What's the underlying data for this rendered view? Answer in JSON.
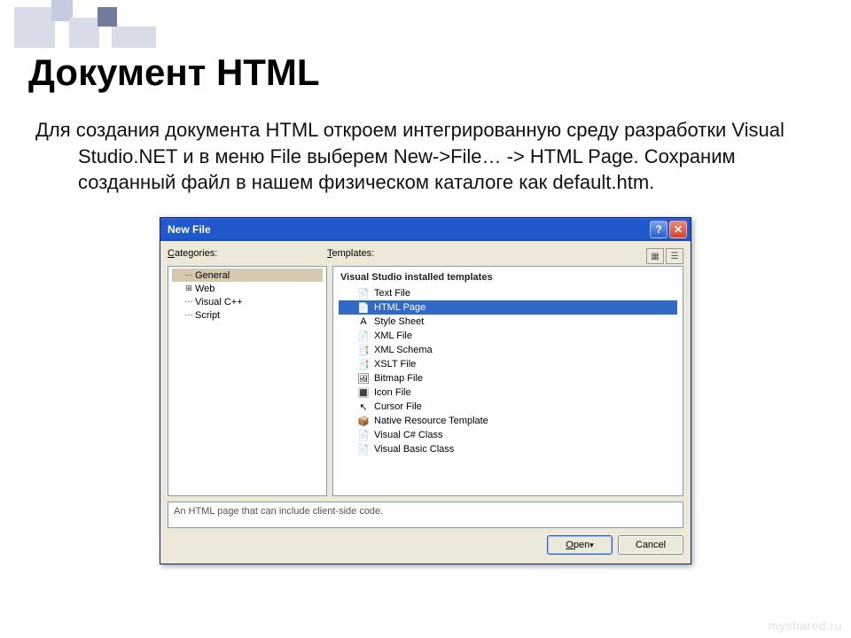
{
  "slide": {
    "title": "Документ HTML",
    "body": "Для создания документа HTML откроем интегрированную среду разработки Visual Studio.NET и в меню File выберем New->File… -> HTML Page. Сохраним созданный файл в нашем физическом каталоге как default.htm.",
    "watermark": "myshared.ru"
  },
  "dialog": {
    "title": "New File",
    "categories_label": "Categories:",
    "templates_label": "Templates:",
    "categories": [
      {
        "label": "General",
        "selected": true,
        "expandable": false
      },
      {
        "label": "Web",
        "selected": false,
        "expandable": true
      },
      {
        "label": "Visual C++",
        "selected": false,
        "expandable": false
      },
      {
        "label": "Script",
        "selected": false,
        "expandable": false
      }
    ],
    "templates_group": "Visual Studio installed templates",
    "templates": [
      {
        "label": "Text File",
        "icon": "📄",
        "selected": false
      },
      {
        "label": "HTML Page",
        "icon": "📄",
        "selected": true
      },
      {
        "label": "Style Sheet",
        "icon": "A",
        "selected": false
      },
      {
        "label": "XML File",
        "icon": "📄",
        "selected": false
      },
      {
        "label": "XML Schema",
        "icon": "📑",
        "selected": false
      },
      {
        "label": "XSLT File",
        "icon": "📑",
        "selected": false
      },
      {
        "label": "Bitmap File",
        "icon": "🖼",
        "selected": false
      },
      {
        "label": "Icon File",
        "icon": "🔳",
        "selected": false
      },
      {
        "label": "Cursor File",
        "icon": "↖",
        "selected": false
      },
      {
        "label": "Native Resource Template",
        "icon": "📦",
        "selected": false
      },
      {
        "label": "Visual C# Class",
        "icon": "📄",
        "selected": false
      },
      {
        "label": "Visual Basic Class",
        "icon": "📄",
        "selected": false
      }
    ],
    "description": "An HTML page that can include client-side code.",
    "open_label": "Open",
    "cancel_label": "Cancel"
  }
}
